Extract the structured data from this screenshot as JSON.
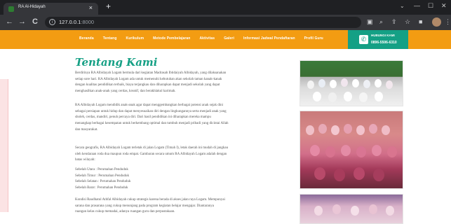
{
  "browser": {
    "tab_title": "RA Al-Hidayah",
    "tab_close": "×",
    "new_tab": "+",
    "url_host": "127.0.0.1",
    "url_port": ":8000",
    "nav": {
      "back": "←",
      "forward": "→",
      "reload": "C"
    },
    "window": {
      "minimize": "—",
      "maximize": "☐",
      "close": "✕",
      "tab_search": "⌄"
    }
  },
  "site_nav": {
    "links": [
      "Beranda",
      "Tentang",
      "Kurikulum",
      "Metode Pembelajaran",
      "Aktivitas",
      "Galeri",
      "Informasi Jadwal Pendaftaran",
      "Profil Guru"
    ],
    "contact_label": "HUBUNGI KAMI",
    "contact_phone": "0896-5506-6310"
  },
  "about": {
    "title": "Tentang Kami",
    "p1": [
      "Berdirinya RA Albidayah Logam bermula dari kegiatan Madrasah Ibtidaiyah Albidayah, yang dilaksanakan",
      "setiap sore hari. RA Albidayah Logam ada untuk memenuhi kebutuhan akan sekolah taman kanak-kanak",
      "dengan kualitas pendidikan terbaik, biaya terjangkau dan diharapkan dapat menjadi sekolah yang dapat",
      "menghasilkan anak-anak yang cerdas, kreatif, dan berakhlakul karimah."
    ],
    "p2": [
      "RA Albidayah Logam mendidik anak-anak agar dapat menggembangkan berbagai potensi anak sejak dini",
      "sebagai persiapan untuk hidup dan dapat menyesuaikan diri dengan lingkungannya serta menjadi anak yang",
      "sholeh, cerdas, mandiri, penuh percaya diri. Dari hasil pendidikan ini diharapkan mereka mampu",
      "menangkap berbagai kesempatan untuk berkembang optimal dan tumbuh menjadi pribadi yang dicintai Allah",
      "dan masyarakat."
    ],
    "p3": [
      "Secara geografis, RA Albidayah Logam terletak di jalan Logam (Timah I), letak daerah ini mudah di jangkau",
      "oleh kendaraan roda dua maupun roda empat. Gambaran secara umum RA Albidayah Logam adalah dengan",
      "batas wilayah:"
    ],
    "p4": [
      "Sebelah Utara : Perumahan Penduduk",
      "Sebelah Timur : Perumahan Penduduk",
      "Sebelah Selatan : Perumahan Penduduk",
      "Sebelah Barat : Perumahan Penduduk"
    ],
    "p5": [
      "Kondisi Raudhatul Athfal Albidayah cukup strategis karena berada di akses jalan raya Logam. Mempunyai",
      "sarana dan prasarana yang cukup menunjang pada program kegiatan belajar mengajar. Diantaranya",
      "ruangan kelas cukup memadai, adanya ruangan guru dan perpustakaan."
    ]
  },
  "colors": {
    "nav_bg": "#f39c12",
    "contact_bg": "#14a085",
    "heading": "#16a085"
  }
}
